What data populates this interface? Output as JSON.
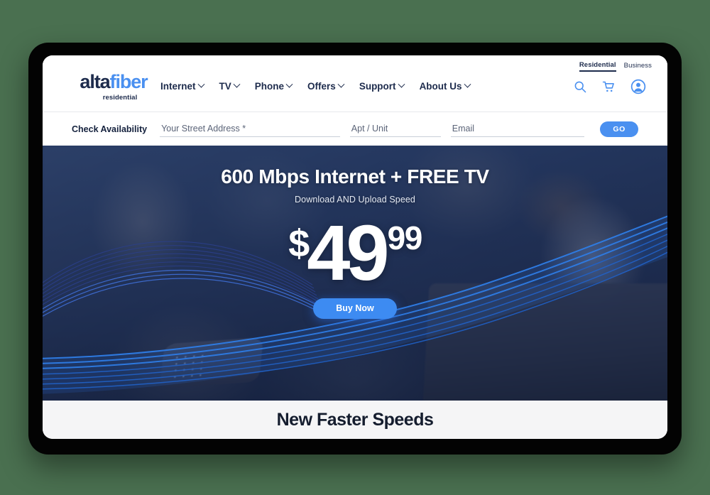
{
  "utility": {
    "residential": "Residential",
    "business": "Business"
  },
  "brand": {
    "word_alta": "alta",
    "word_fiber": "fiber",
    "sub": "residential",
    "accent_blue": "#4a90f0",
    "navy": "#1d2b4c"
  },
  "nav": {
    "items": [
      {
        "label": "Internet"
      },
      {
        "label": "TV"
      },
      {
        "label": "Phone"
      },
      {
        "label": "Offers"
      },
      {
        "label": "Support"
      },
      {
        "label": "About Us"
      }
    ],
    "icons": [
      {
        "name": "search-icon"
      },
      {
        "name": "cart-icon"
      },
      {
        "name": "account-icon"
      }
    ]
  },
  "availability": {
    "label": "Check Availability",
    "street_placeholder": "Your Street Address *",
    "street_value": "",
    "apt_placeholder": "Apt / Unit",
    "apt_value": "",
    "email_placeholder": "Email",
    "email_value": "",
    "go_label": "GO"
  },
  "hero": {
    "headline": "600 Mbps Internet + FREE TV",
    "subtitle": "Download AND Upload Speed",
    "price_currency": "$",
    "price_dollars": "49",
    "price_cents": "99",
    "cta_label": "Buy Now",
    "cta_color": "#3d8bf2"
  },
  "promo": {
    "title": "New Faster Speeds"
  },
  "page": {
    "background_color": "#4a7050",
    "frame_color": "#030303"
  }
}
